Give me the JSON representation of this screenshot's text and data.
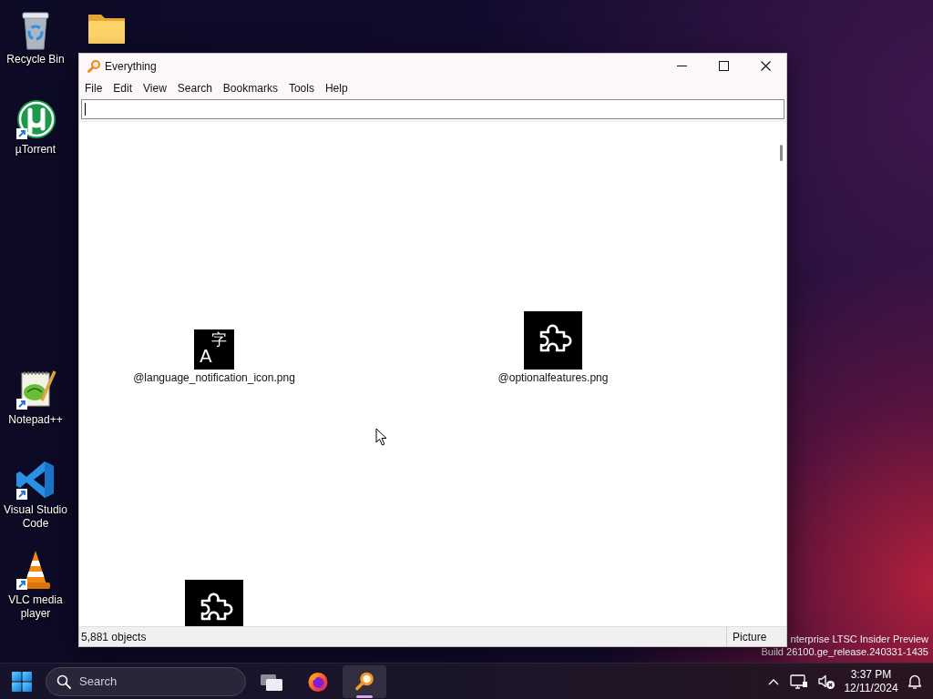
{
  "desktop": {
    "icons": [
      {
        "kind": "recycle_bin",
        "label": "Recycle Bin",
        "shortcut": false
      },
      {
        "kind": "folder",
        "shortcut": false
      },
      {
        "kind": "utorrent",
        "label": "µTorrent",
        "shortcut": true
      },
      {
        "kind": "notepadpp",
        "label": "Notepad++",
        "shortcut": true
      },
      {
        "kind": "vscode",
        "label": "Visual Studio Code",
        "shortcut": true
      },
      {
        "kind": "vlc",
        "label": "VLC media player",
        "shortcut": true
      }
    ],
    "build_info": [
      "nterprise LTSC Insider Preview",
      "Build 26100.ge_release.240331-1435"
    ]
  },
  "window": {
    "title": "Everything",
    "menu": [
      "File",
      "Edit",
      "View",
      "Search",
      "Bookmarks",
      "Tools",
      "Help"
    ],
    "search": {
      "focused": true
    },
    "results": [
      {
        "kind": "language",
        "glyphs": [
          "A",
          "字"
        ],
        "name": "@language_notification_icon.png"
      },
      {
        "kind": "puzzle",
        "name": "@optionalfeatures.png"
      },
      {
        "kind": "puzzle"
      }
    ],
    "status_bar": {
      "count": "5,881 objects",
      "filter": "Picture"
    }
  },
  "taskbar": {
    "search": {
      "placeholder": "Search"
    },
    "apps": [
      {
        "kind": "firefox",
        "selected": false
      },
      {
        "kind": "everything",
        "selected": true
      }
    ],
    "tray": {
      "volume_muted": true
    },
    "clock": {
      "time": "3:37 PM",
      "date": "12/11/2024"
    }
  }
}
